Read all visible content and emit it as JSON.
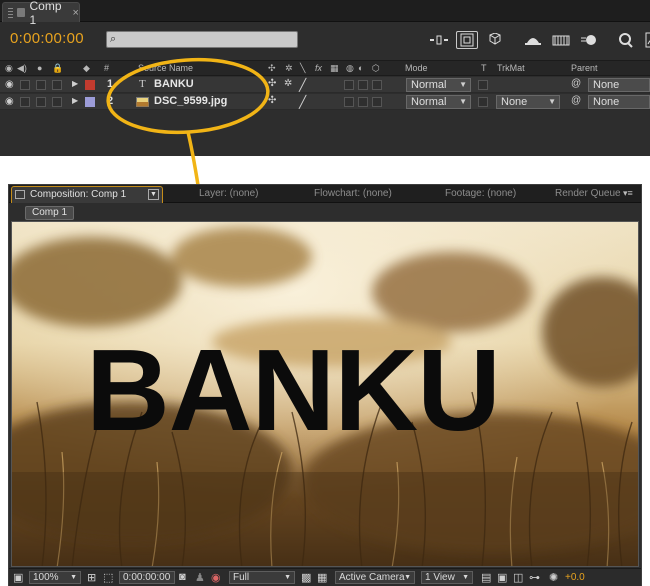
{
  "timeline": {
    "tab_title": "Comp 1",
    "tab_close": "×",
    "current_time": "0:00:00:00",
    "search_placeholder": "",
    "search_icon": "⌕",
    "toolbar_icons": [
      "ripple-icon",
      "composition-mini-flowchart-icon",
      "draft-3d-icon",
      "hide-shy-icon",
      "frame-blending-icon",
      "motion-blur-icon",
      "brainstorm-icon",
      "graph-editor-icon"
    ],
    "columns": {
      "hash": "#",
      "source_name": "Source Name",
      "switches": "fx",
      "mode": "Mode",
      "t": "T",
      "trkmat": "TrkMat",
      "parent": "Parent"
    },
    "layers": [
      {
        "index": "1",
        "name": "BANKU",
        "type": "text-layer-icon",
        "label_color": "#c23b2f",
        "mode": "Normal",
        "trkmat": "",
        "parent": "None"
      },
      {
        "index": "2",
        "name": "DSC_9599.jpg",
        "type": "footage-layer-icon",
        "label_color": "#9c9cd8",
        "mode": "Normal",
        "trkmat": "None",
        "parent": "None"
      }
    ]
  },
  "composition": {
    "panel_tab": "Composition: Comp 1",
    "other_tabs": [
      "Layer: (none)",
      "Flowchart: (none)",
      "Footage: (none)",
      "Render Queue"
    ],
    "comp_chip": "Comp 1",
    "canvas_text": "BANKU",
    "footer": {
      "zoom": "100%",
      "timecode": "0:00:00:00",
      "resolution": "Full",
      "camera": "Active Camera",
      "views": "1 View",
      "exposure": "+0.0"
    }
  },
  "colors": {
    "accent_orange": "#e8a31f",
    "annotation_yellow": "#f1b416"
  }
}
